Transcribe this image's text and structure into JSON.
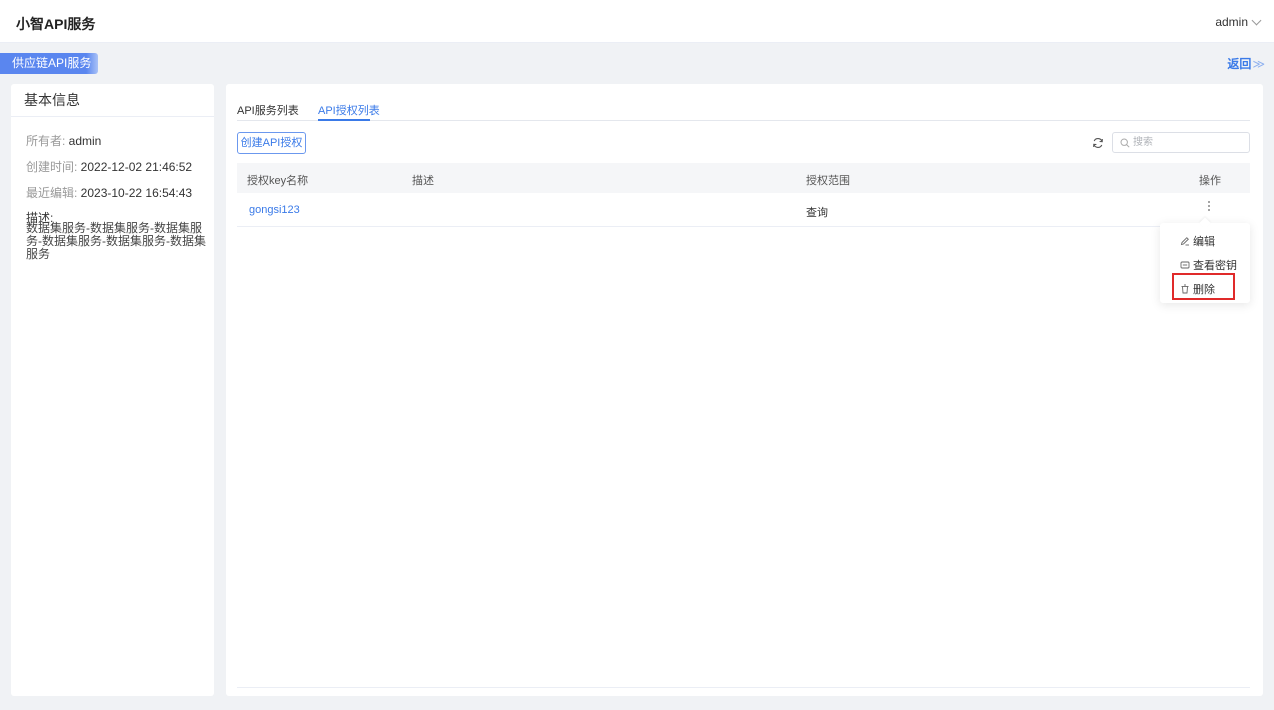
{
  "header": {
    "app_title": "小智API服务",
    "user_name": "admin"
  },
  "breadcrumb": {
    "tag_label": "供应链API服务",
    "back_label": "返回",
    "back_symbol": "≫"
  },
  "info_card": {
    "title": "基本信息",
    "owner_key": "所有者: ",
    "owner_value": "admin",
    "created_key": "创建时间: ",
    "created_value": "2022-12-02 21:46:52",
    "edited_key": "最近编辑: ",
    "edited_value": "2023-10-22 16:54:43",
    "desc_key": "描述:",
    "desc_value": "数据集服务-数据集服务-数据集服务-数据集服务-数据集服务-数据集服务"
  },
  "tabs": [
    {
      "label": "API服务列表",
      "active": false
    },
    {
      "label": "API授权列表",
      "active": true
    }
  ],
  "toolbar": {
    "create_label": "创建API授权",
    "search_placeholder": "搜索"
  },
  "table": {
    "columns": [
      "授权key名称",
      "描述",
      "授权范围",
      "操作"
    ],
    "rows": [
      {
        "name": "gongsi123",
        "desc": "",
        "scope": "查询"
      }
    ]
  },
  "row_menu": {
    "items": [
      {
        "label": "编辑",
        "icon": "edit-icon"
      },
      {
        "label": "查看密钥",
        "icon": "key-view-icon"
      },
      {
        "label": "删除",
        "icon": "trash-icon"
      }
    ]
  },
  "colors": {
    "accent": "#3a7ae8",
    "highlight": "#e02a2a"
  }
}
